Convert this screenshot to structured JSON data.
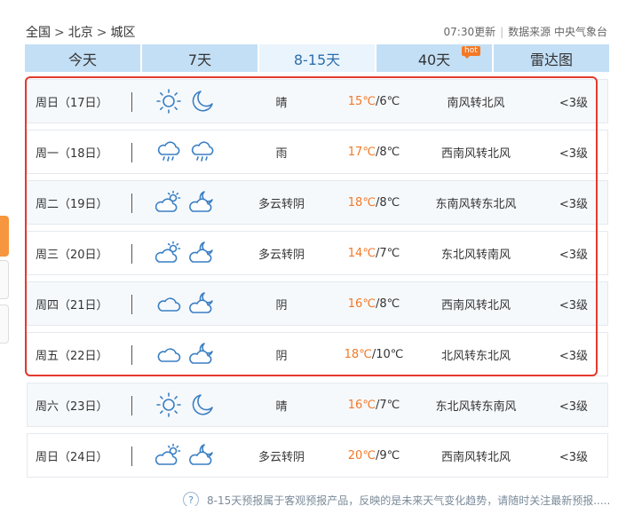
{
  "breadcrumb": {
    "country": "全国",
    "city": "北京",
    "district": "城区",
    "sep": ">"
  },
  "update": {
    "time": "07:30更新",
    "divider": "|",
    "source": "数据来源 中央气象台"
  },
  "tabs": [
    {
      "label": "今天"
    },
    {
      "label": "7天"
    },
    {
      "label": "8-15天",
      "active": true
    },
    {
      "label": "40天",
      "badge": "hot"
    },
    {
      "label": "雷达图"
    }
  ],
  "days": [
    {
      "day": "周日（17日）",
      "icons": [
        "sun-icon",
        "moon-icon"
      ],
      "desc": "晴",
      "hi": "15℃",
      "lo": "/6℃",
      "wind": "南风转北风",
      "level": "<3级"
    },
    {
      "day": "周一（18日）",
      "icons": [
        "rain-icon",
        "rain-icon"
      ],
      "desc": "雨",
      "hi": "17℃",
      "lo": "/8℃",
      "wind": "西南风转北风",
      "level": "<3级"
    },
    {
      "day": "周二（19日）",
      "icons": [
        "partly-cloudy-icon",
        "cloudy-night-icon"
      ],
      "desc": "多云转阴",
      "hi": "18℃",
      "lo": "/8℃",
      "wind": "东南风转东北风",
      "level": "<3级"
    },
    {
      "day": "周三（20日）",
      "icons": [
        "partly-cloudy-icon",
        "cloudy-night-icon"
      ],
      "desc": "多云转阴",
      "hi": "14℃",
      "lo": "/7℃",
      "wind": "东北风转南风",
      "level": "<3级"
    },
    {
      "day": "周四（21日）",
      "icons": [
        "cloud-icon",
        "cloudy-night-icon"
      ],
      "desc": "阴",
      "hi": "16℃",
      "lo": "/8℃",
      "wind": "西南风转北风",
      "level": "<3级"
    },
    {
      "day": "周五（22日）",
      "icons": [
        "cloud-icon",
        "cloudy-night-icon"
      ],
      "desc": "阴",
      "hi": "18℃",
      "lo": "/10℃",
      "wind": "北风转东北风",
      "level": "<3级"
    },
    {
      "day": "周六（23日）",
      "icons": [
        "sun-icon",
        "moon-icon"
      ],
      "desc": "晴",
      "hi": "16℃",
      "lo": "/7℃",
      "wind": "东北风转东南风",
      "level": "<3级"
    },
    {
      "day": "周日（24日）",
      "icons": [
        "partly-cloudy-icon",
        "cloudy-night-icon"
      ],
      "desc": "多云转阴",
      "hi": "20℃",
      "lo": "/9℃",
      "wind": "西南风转北风",
      "level": "<3级"
    }
  ],
  "note": {
    "qmark": "?",
    "text": "8-15天预报属于客观预报产品，反映的是未来天气变化趋势，请随时关注最新预报....."
  },
  "colors": {
    "accent": "#f37826",
    "tab_bg": "#c3dff5",
    "active_tab_text": "#2b6dae",
    "highlight": "#e33a2d"
  }
}
